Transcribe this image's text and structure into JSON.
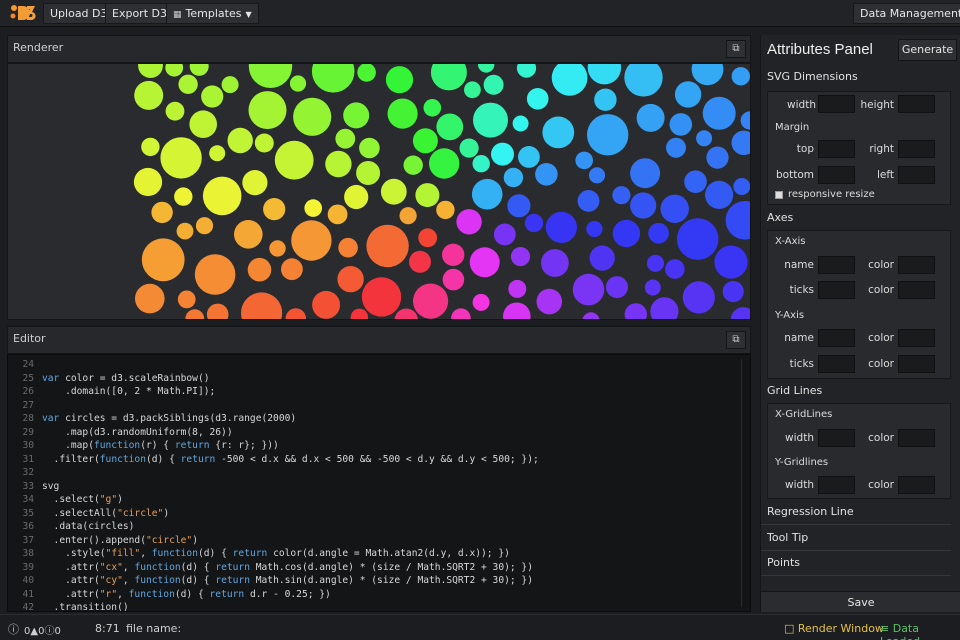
{
  "toolbar": {
    "upload_label": "Upload D3",
    "export_label": "Export D3",
    "templates_label": "Templates",
    "data_management_label": "Data Management"
  },
  "renderer": {
    "title": "Renderer"
  },
  "editor": {
    "title": "Editor",
    "lines": [
      {
        "n": "24",
        "code": ""
      },
      {
        "n": "25",
        "code": "var color = d3.scaleRainbow()"
      },
      {
        "n": "26",
        "code": "    .domain([0, 2 * Math.PI]);"
      },
      {
        "n": "27",
        "code": ""
      },
      {
        "n": "28",
        "code": "var circles = d3.packSiblings(d3.range(2000)"
      },
      {
        "n": "29",
        "code": "    .map(d3.randomUniform(8, 26))"
      },
      {
        "n": "30",
        "code": "    .map(function(r) { return {r: r}; }))"
      },
      {
        "n": "31",
        "code": "  .filter(function(d) { return -500 < d.x && d.x < 500 && -500 < d.y && d.y < 500; });"
      },
      {
        "n": "32",
        "code": ""
      },
      {
        "n": "33",
        "code": "svg"
      },
      {
        "n": "34",
        "code": "  .select(\"g\")"
      },
      {
        "n": "35",
        "code": "  .selectAll(\"circle\")"
      },
      {
        "n": "36",
        "code": "  .data(circles)"
      },
      {
        "n": "37",
        "code": "  .enter().append(\"circle\")"
      },
      {
        "n": "38",
        "code": "    .style(\"fill\", function(d) { return color(d.angle = Math.atan2(d.y, d.x)); })"
      },
      {
        "n": "39",
        "code": "    .attr(\"cx\", function(d) { return Math.cos(d.angle) * (size / Math.SQRT2 + 30); })"
      },
      {
        "n": "40",
        "code": "    .attr(\"cy\", function(d) { return Math.sin(d.angle) * (size / Math.SQRT2 + 30); })"
      },
      {
        "n": "41",
        "code": "    .attr(\"r\", function(d) { return d.r - 0.25; })"
      },
      {
        "n": "42",
        "code": "  .transition()"
      }
    ]
  },
  "attributes": {
    "title": "Attributes Panel",
    "generate_label": "Generate",
    "svg_dimensions": {
      "title": "SVG Dimensions",
      "width_label": "width",
      "height_label": "height",
      "margin_label": "Margin",
      "top_label": "top",
      "right_label": "right",
      "bottom_label": "bottom",
      "left_label": "left",
      "responsive_label": "responsive resize"
    },
    "axes": {
      "title": "Axes",
      "x_axis_label": "X-Axis",
      "y_axis_label": "Y-Axis",
      "name_label": "name",
      "color_label": "color",
      "ticks_label": "ticks"
    },
    "grid_lines": {
      "title": "Grid Lines",
      "x_label": "X-GridLines",
      "y_label": "Y-Gridlines",
      "width_label": "width",
      "color_label": "color"
    },
    "regression_line_label": "Regression Line",
    "tool_tip_label": "Tool Tip",
    "points_label": "Points",
    "save_label": "Save"
  },
  "status": {
    "errors": "0",
    "warnings": "0",
    "infos": "0",
    "cursor": "8:71",
    "file_label": "file name:",
    "render_window_label": "Render Window",
    "data_loaded_label": "Data Loaded"
  },
  "colors": {
    "accent_yellow": "#e3c24a",
    "accent_green": "#5bc06a"
  }
}
